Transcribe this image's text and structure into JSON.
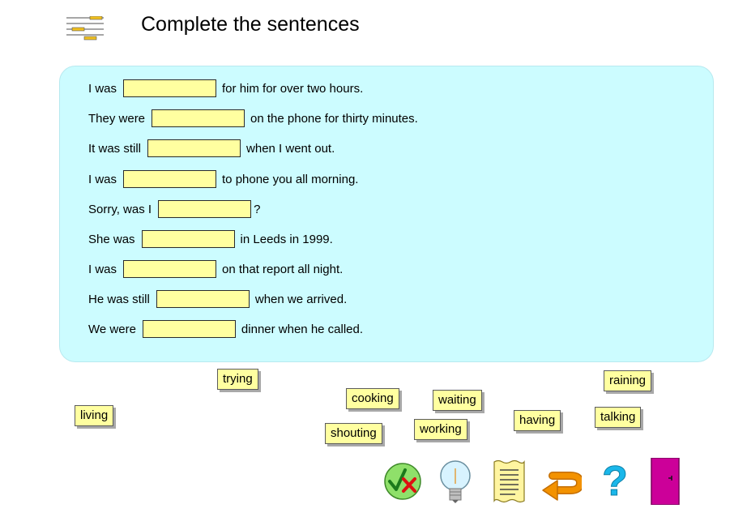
{
  "header": {
    "title": "Complete the sentences",
    "logo_icon": "text-lines-icon"
  },
  "sentences": [
    {
      "before": "I was",
      "after": "for him for over two hours."
    },
    {
      "before": "They were",
      "after": "on the phone for thirty minutes."
    },
    {
      "before": "It was still",
      "after": "when I went out."
    },
    {
      "before": "I was",
      "after": "to phone you all morning."
    },
    {
      "before": "Sorry, was I",
      "after": "?"
    },
    {
      "before": "She was",
      "after": "in Leeds in 1999."
    },
    {
      "before": "I was",
      "after": "on that report all night."
    },
    {
      "before": "He was still",
      "after": "when we arrived."
    },
    {
      "before": "We were",
      "after": "dinner when he called."
    }
  ],
  "word_bank": [
    "trying",
    "raining",
    "cooking",
    "waiting",
    "living",
    "talking",
    "having",
    "working",
    "shouting"
  ],
  "toolbar": {
    "check_icon": "check-cross-icon",
    "hint_icon": "lightbulb-icon",
    "text_icon": "document-icon",
    "reset_icon": "undo-arrow-icon",
    "help_icon": "question-mark-icon",
    "exit_icon": "exit-door-icon"
  },
  "colors": {
    "panel": "#ccfcff",
    "blank": "#ffffa0",
    "help": "#1ab7ea",
    "exit": "#cc0099",
    "reset": "#f39200"
  }
}
